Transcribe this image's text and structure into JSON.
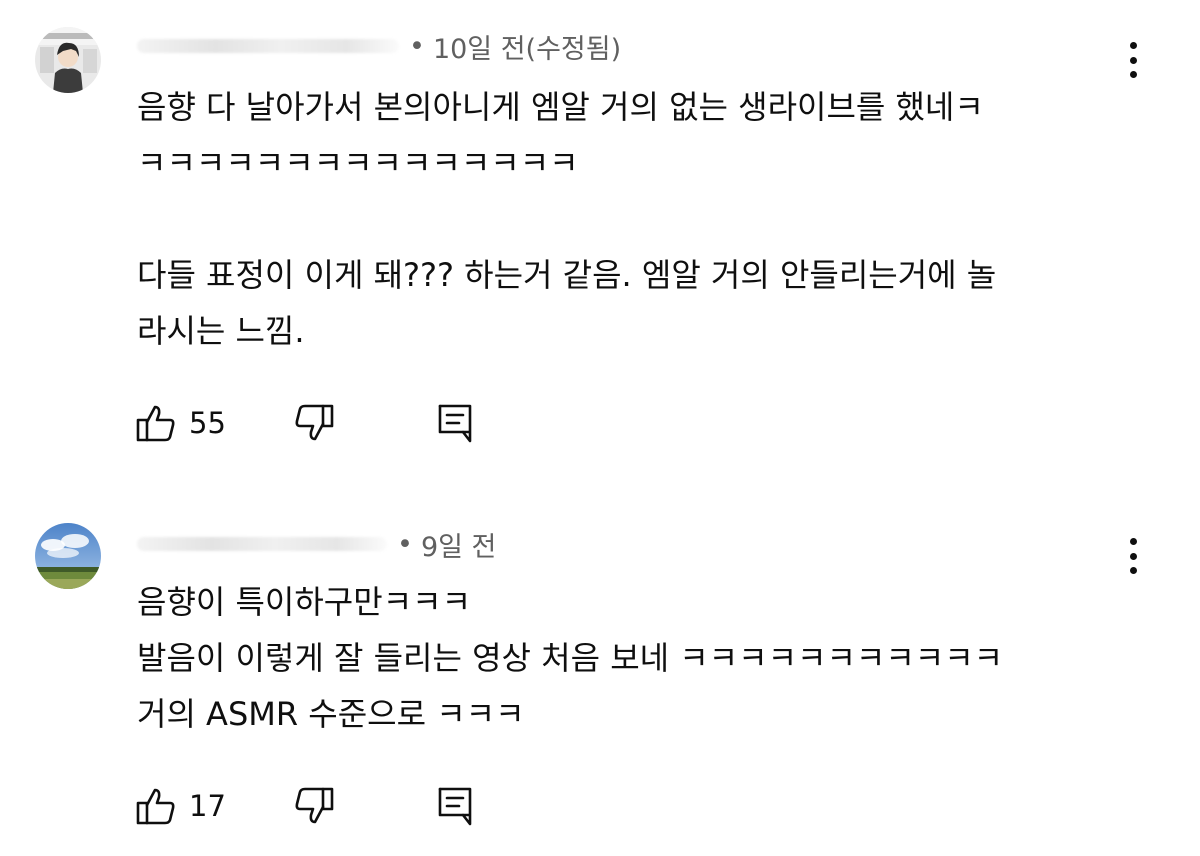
{
  "comments": [
    {
      "timestamp": "10일 전(수정됨)",
      "text": "음향 다 날아가서 본의아니게 엠알 거의 없는 생라이브를 했네ㅋ\nㅋㅋㅋㅋㅋㅋㅋㅋㅋㅋㅋㅋㅋㅋㅋ\n\n다들 표정이 이게 돼??? 하는거 같음. 엠알 거의 안들리는거에 놀\n라시는 느낌.",
      "like_count": "55"
    },
    {
      "timestamp": "9일 전",
      "text": "음향이 특이하구만ㅋㅋㅋ\n발음이 이렇게 잘 들리는 영상 처음 보네 ㅋㅋㅋㅋㅋㅋㅋㅋㅋㅋㅋ\n거의 ASMR 수준으로 ㅋㅋㅋ",
      "like_count": "17"
    }
  ],
  "separator": "•",
  "icons": {
    "like": "thumbs-up-icon",
    "dislike": "thumbs-down-icon",
    "reply": "reply-comment-icon",
    "more": "more-vertical-icon"
  },
  "colors": {
    "text": "#0f0f0f",
    "meta": "#606060"
  }
}
